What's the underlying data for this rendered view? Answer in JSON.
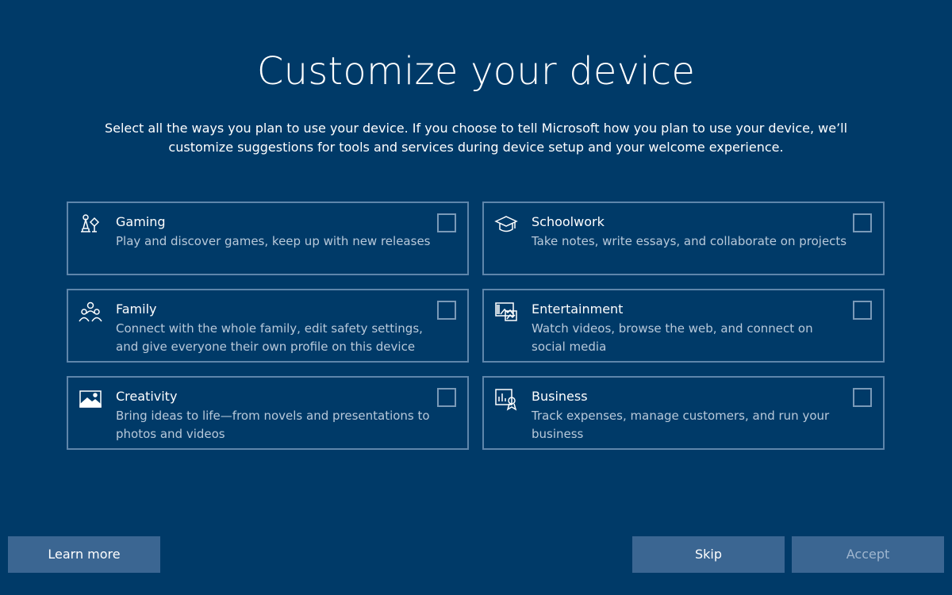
{
  "header": {
    "title": "Customize your device",
    "subtitle": "Select all the ways you plan to use your device. If you choose to tell Microsoft how you plan to use your device, we’ll customize suggestions for tools and services during device setup and your welcome experience."
  },
  "options": [
    {
      "title": "Gaming",
      "description": "Play and discover games, keep up with new releases",
      "icon": "gaming-icon",
      "checked": false
    },
    {
      "title": "Schoolwork",
      "description": "Take notes, write essays, and collaborate on projects",
      "icon": "graduation-cap-icon",
      "checked": false
    },
    {
      "title": "Family",
      "description": "Connect with the whole family, edit safety settings, and give everyone their own profile on this device",
      "icon": "family-icon",
      "checked": false
    },
    {
      "title": "Entertainment",
      "description": "Watch videos, browse the web, and connect on social media",
      "icon": "entertainment-icon",
      "checked": false
    },
    {
      "title": "Creativity",
      "description": "Bring ideas to life—from novels and presentations to photos and videos",
      "icon": "picture-icon",
      "checked": false
    },
    {
      "title": "Business",
      "description": "Track expenses, manage customers, and run your business",
      "icon": "business-chart-icon",
      "checked": false
    }
  ],
  "footer": {
    "learn_more_label": "Learn more",
    "skip_label": "Skip",
    "accept_label": "Accept"
  },
  "colors": {
    "background": "#003a68",
    "card_border": "#5f86ab",
    "button_bg": "#3b6692",
    "description_text": "#b8c9da"
  }
}
